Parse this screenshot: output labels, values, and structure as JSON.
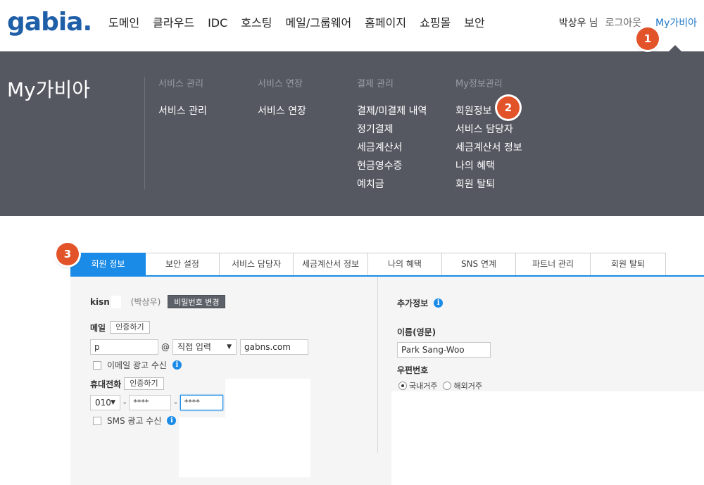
{
  "brand": {
    "logo_text": "gabia",
    "logo_dot": "."
  },
  "main_nav": [
    "도메인",
    "클라우드",
    "IDC",
    "호스팅",
    "메일/그룹웨어",
    "홈페이지",
    "쇼핑몰",
    "보안"
  ],
  "user_nav": {
    "name": "박상우",
    "suffix": "님",
    "logout": "로그아웃",
    "my_gabia": "My가비아"
  },
  "badges": [
    "1",
    "2",
    "3"
  ],
  "mega": {
    "title": "My가비아",
    "columns": [
      {
        "head": "서비스 관리",
        "items": [
          "서비스 관리"
        ]
      },
      {
        "head": "서비스 연장",
        "items": [
          "서비스 연장"
        ]
      },
      {
        "head": "결제 관리",
        "items": [
          "결제/미결제 내역",
          "정기결제",
          "세금계산서",
          "현금영수증",
          "예치금"
        ]
      },
      {
        "head": "My정보관리",
        "items": [
          "회원정보",
          "서비스 담당자",
          "세금계산서 정보",
          "나의 혜택",
          "회원 탈퇴"
        ]
      }
    ]
  },
  "tabs": [
    "회원 정보",
    "보안 설정",
    "서비스 담당자",
    "세금계산서 정보",
    "나의 혜택",
    "SNS 연계",
    "파트너 관리",
    "회원 탈퇴"
  ],
  "member": {
    "user_id": "kisn",
    "real_name": "(박상우)",
    "change_password": "비밀번호 변경",
    "mail_label": "메일",
    "verify_label": "인증하기",
    "email_local": "p",
    "at_sign": "@",
    "domain_select": "직접 입력",
    "email_domain": "gabns.com",
    "email_ad_opt": "이메일 광고 수신",
    "phone_label": "휴대전화",
    "phone_prefix": "010",
    "phone_mid": "****",
    "phone_last": "****",
    "dash": "-",
    "sms_ad_opt": "SMS 광고 수신"
  },
  "extra": {
    "title": "추가정보",
    "eng_name_label": "이름(영문)",
    "eng_name_value": "Park Sang-Woo",
    "postal_label": "우편번호",
    "domestic": "국내거주",
    "overseas": "해외거주"
  },
  "colors": {
    "accent": "#1a8be6",
    "badge": "#e2532a",
    "mega_bg": "#555861",
    "logo": "#1f5fa8"
  }
}
